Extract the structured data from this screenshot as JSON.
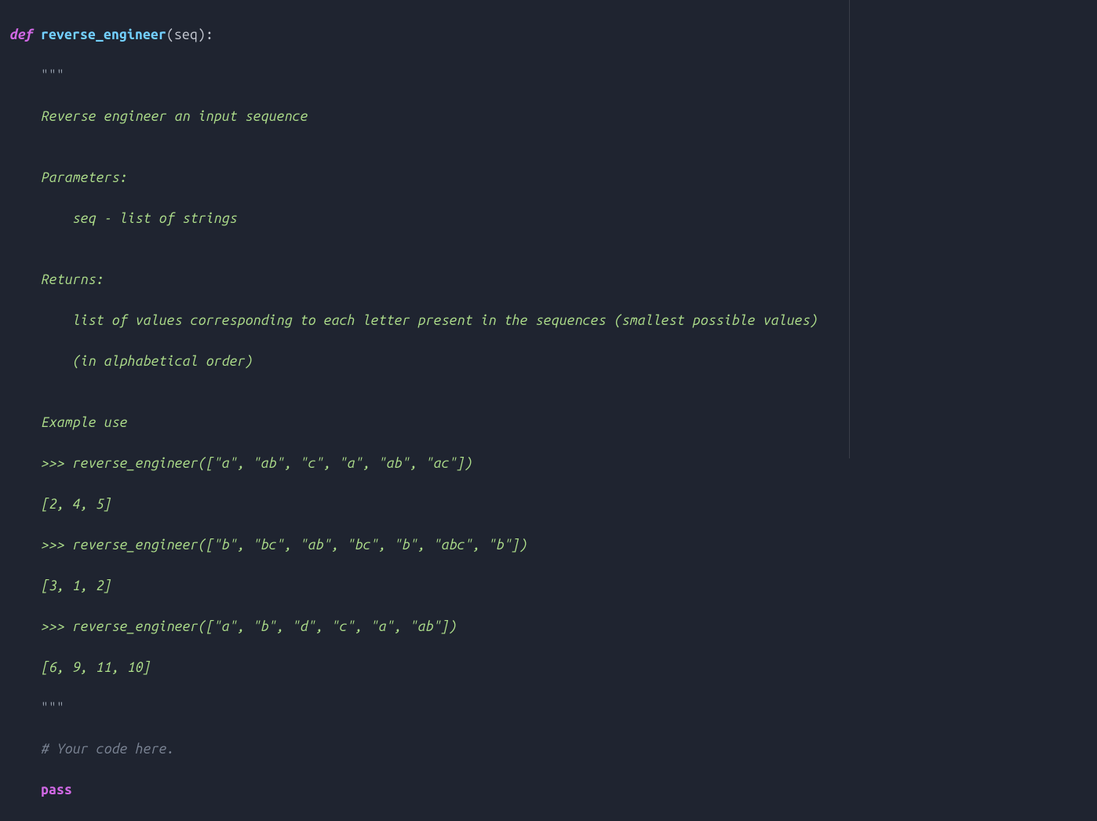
{
  "code": {
    "l1_def": "def",
    "l1_fn": "reverse_engineer",
    "l1_open": "(",
    "l1_param": "seq",
    "l1_close": "):",
    "l2_q": "    \"\"\"",
    "l3": "    Reverse engineer an input sequence",
    "l4": "",
    "l5": "    Parameters:",
    "l6": "        seq - list of strings",
    "l7": "",
    "l8": "    Returns:",
    "l9": "        list of values corresponding to each letter present in the sequences (smallest possible values)",
    "l10": "        (in alphabetical order)",
    "l11": "",
    "l12": "    Example use",
    "l13": "    >>> reverse_engineer([\"a\", \"ab\", \"c\", \"a\", \"ab\", \"ac\"])",
    "l14": "    [2, 4, 5]",
    "l15": "    >>> reverse_engineer([\"b\", \"bc\", \"ab\", \"bc\", \"b\", \"abc\", \"b\"])",
    "l16": "    [3, 1, 2]",
    "l17": "    >>> reverse_engineer([\"a\", \"b\", \"d\", \"c\", \"a\", \"ab\"])",
    "l18": "    [6, 9, 11, 10]",
    "l19_q": "    \"\"\"",
    "l20": "    # Your code here.",
    "l21_indent": "    ",
    "l21_pass": "pass"
  }
}
